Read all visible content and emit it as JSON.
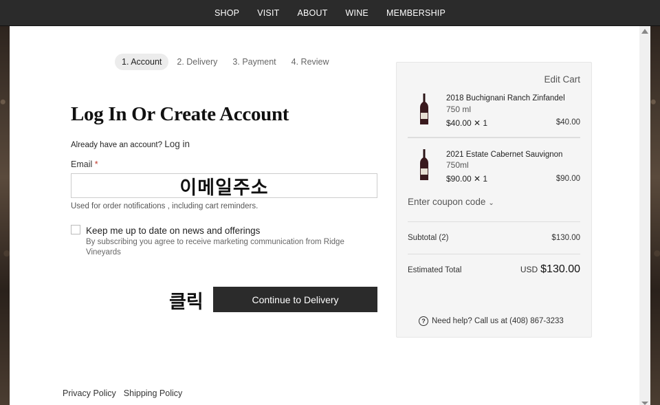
{
  "nav": {
    "items": [
      "SHOP",
      "VISIT",
      "ABOUT",
      "WINE",
      "MEMBERSHIP"
    ]
  },
  "steps": [
    "1. Account",
    "2. Delivery",
    "3. Payment",
    "4. Review"
  ],
  "account": {
    "title": "Log In Or Create Account",
    "already_text": "Already have an account?",
    "login_link": "Log in",
    "email_label": "Email",
    "required_mark": "*",
    "email_value": "이메일주소",
    "email_hint": "Used for order notifications , including cart reminders.",
    "newsletter_label": "Keep me up to date on news and offerings",
    "newsletter_sub": "By subscribing you agree to receive marketing communication from Ridge Vineyards",
    "click_annotation": "클릭",
    "continue_label": "Continue to Delivery"
  },
  "cart": {
    "edit_label": "Edit Cart",
    "items": [
      {
        "name": "2018 Buchignani Ranch Zinfandel",
        "size": "750 ml",
        "qty_line": "$40.00 ✕ 1",
        "price": "$40.00"
      },
      {
        "name": "2021 Estate Cabernet Sauvignon",
        "size": "750ml",
        "qty_line": "$90.00 ✕ 1",
        "price": "$90.00"
      }
    ],
    "coupon_label": "Enter coupon code",
    "subtotal_label": "Subtotal (2)",
    "subtotal_value": "$130.00",
    "total_label": "Estimated Total",
    "total_currency": "USD",
    "total_value": "$130.00",
    "help_text": "Need help? Call us at (408) 867-3233"
  },
  "footer": {
    "links": [
      "Privacy Policy",
      "Shipping Policy"
    ]
  }
}
